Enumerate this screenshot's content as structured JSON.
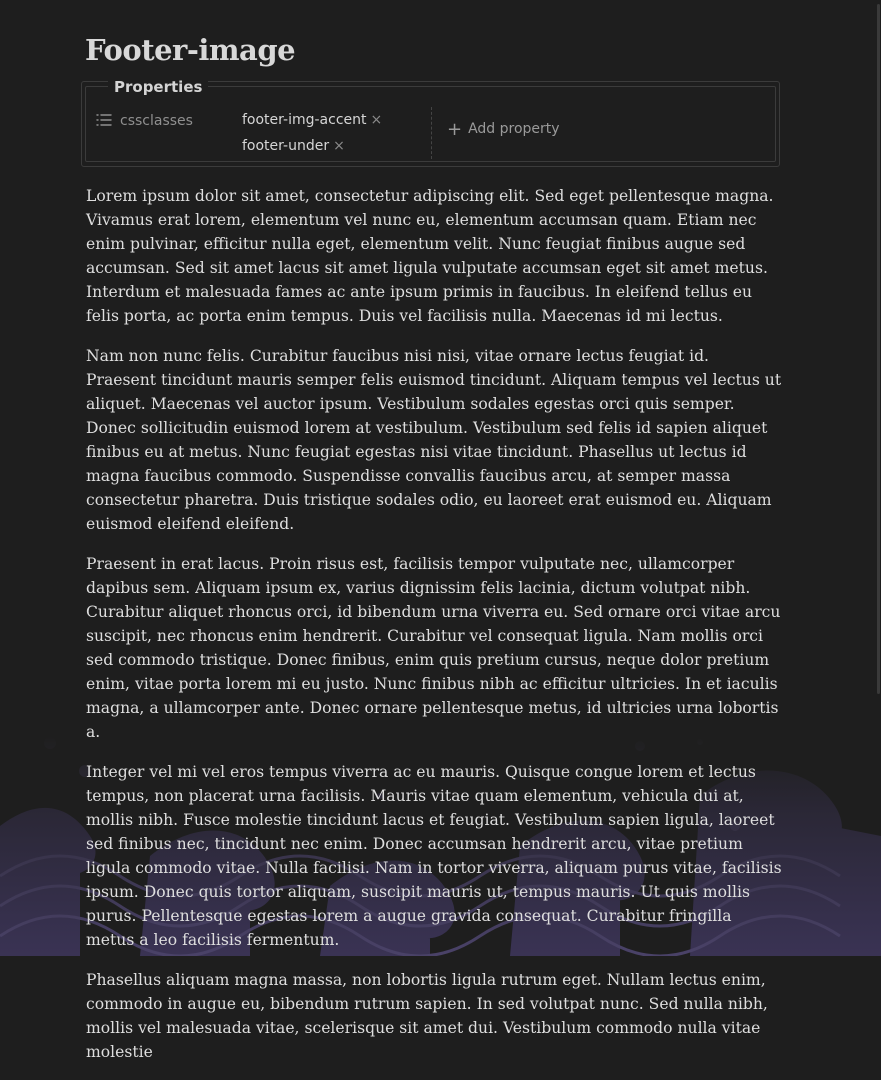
{
  "note": {
    "title": "Footer-image"
  },
  "properties": {
    "heading": "Properties",
    "key": "cssclasses",
    "tags": [
      "footer-img-accent",
      "footer-under"
    ],
    "remove_glyph": "×",
    "add_label": "Add property"
  },
  "paragraphs": [
    "Lorem ipsum dolor sit amet, consectetur adipiscing elit. Sed eget pellentesque magna. Vivamus erat lorem, elementum vel nunc eu, elementum accumsan quam. Etiam nec enim pulvinar, efficitur nulla eget, elementum velit. Nunc feugiat finibus augue sed accumsan. Sed sit amet lacus sit amet ligula vulputate accumsan eget sit amet metus. Interdum et malesuada fames ac ante ipsum primis in faucibus. In eleifend tellus eu felis porta, ac porta enim tempus. Duis vel facilisis nulla. Maecenas id mi lectus.",
    "Nam non nunc felis. Curabitur faucibus nisi nisi, vitae ornare lectus feugiat id. Praesent tincidunt mauris semper felis euismod tincidunt. Aliquam tempus vel lectus ut aliquet. Maecenas vel auctor ipsum. Vestibulum sodales egestas orci quis semper. Donec sollicitudin euismod lorem at vestibulum. Vestibulum sed felis id sapien aliquet finibus eu at metus. Nunc feugiat egestas nisi vitae tincidunt. Phasellus ut lectus id magna faucibus commodo. Suspendisse convallis faucibus arcu, at semper massa consectetur pharetra. Duis tristique sodales odio, eu laoreet erat euismod eu. Aliquam euismod eleifend eleifend.",
    "Praesent in erat lacus. Proin risus est, facilisis tempor vulputate nec, ullamcorper dapibus sem. Aliquam ipsum ex, varius dignissim felis lacinia, dictum volutpat nibh. Curabitur aliquet rhoncus orci, id bibendum urna viverra eu. Sed ornare orci vitae arcu suscipit, nec rhoncus enim hendrerit. Curabitur vel consequat ligula. Nam mollis orci sed commodo tristique. Donec finibus, enim quis pretium cursus, neque dolor pretium enim, vitae porta lorem mi eu justo. Nunc finibus nibh ac efficitur ultricies. In et iaculis magna, a ullamcorper ante. Donec ornare pellentesque metus, id ultricies urna lobortis a.",
    "Integer vel mi vel eros tempus viverra ac eu mauris. Quisque congue lorem et lectus tempus, non placerat urna facilisis. Mauris vitae quam elementum, vehicula dui at, mollis nibh. Fusce molestie tincidunt lacus et feugiat. Vestibulum sapien ligula, laoreet sed finibus nec, tincidunt nec enim. Donec accumsan hendrerit arcu, vitae pretium ligula commodo vitae. Nulla facilisi. Nam in tortor viverra, aliquam purus vitae, facilisis ipsum. Donec quis tortor aliquam, suscipit mauris ut, tempus mauris. Ut quis mollis purus. Pellentesque egestas lorem a augue gravida consequat. Curabitur fringilla metus a leo facilisis fermentum.",
    "Phasellus aliquam magna massa, non lobortis ligula rutrum eget. Nullam lectus enim, commodo in augue eu, bibendum rutrum sapien. In sed volutpat nunc. Sed nulla nibh, mollis vel malesuada vitae, scelerisque sit amet dui. Vestibulum commodo nulla vitae molestie"
  ],
  "icons": {
    "property_type": "list-icon",
    "add": "plus-icon",
    "footer_art": "wave-pattern"
  },
  "colors": {
    "background": "#1e1e1e",
    "text": "#dedede",
    "footer_wave": "#3c3556"
  }
}
